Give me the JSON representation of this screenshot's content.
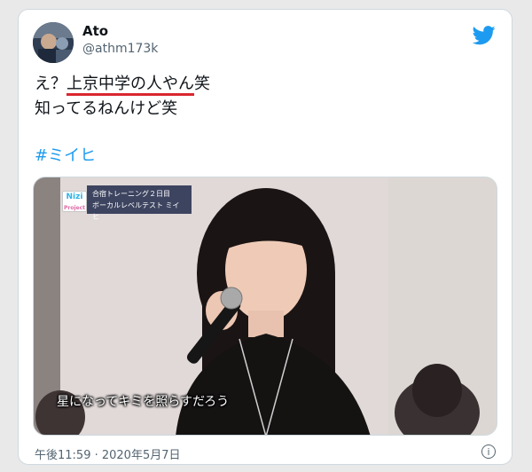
{
  "user": {
    "name": "Ato",
    "handle": "@athm173k"
  },
  "tweet": {
    "line1_prefix": "え？",
    "line1_underlined": "上京中学の人やん",
    "line1_suffix": "笑",
    "line2": "知ってるねんけど笑",
    "hashtag": "#ミイヒ"
  },
  "media": {
    "badge": "Nizi",
    "badge_sub": "Project",
    "caption_line1": "合宿トレーニング２日目",
    "caption_line2": "ボーカルレベルテスト ミイヒ",
    "subtitle": "星になってキミを照らすだろう"
  },
  "footer": {
    "timestamp": "午後11:59 · 2020年5月7日",
    "info": "i"
  },
  "colors": {
    "accent": "#1d9bf0",
    "underline": "#d9272e",
    "text": "#0f1419",
    "muted": "#536471"
  }
}
